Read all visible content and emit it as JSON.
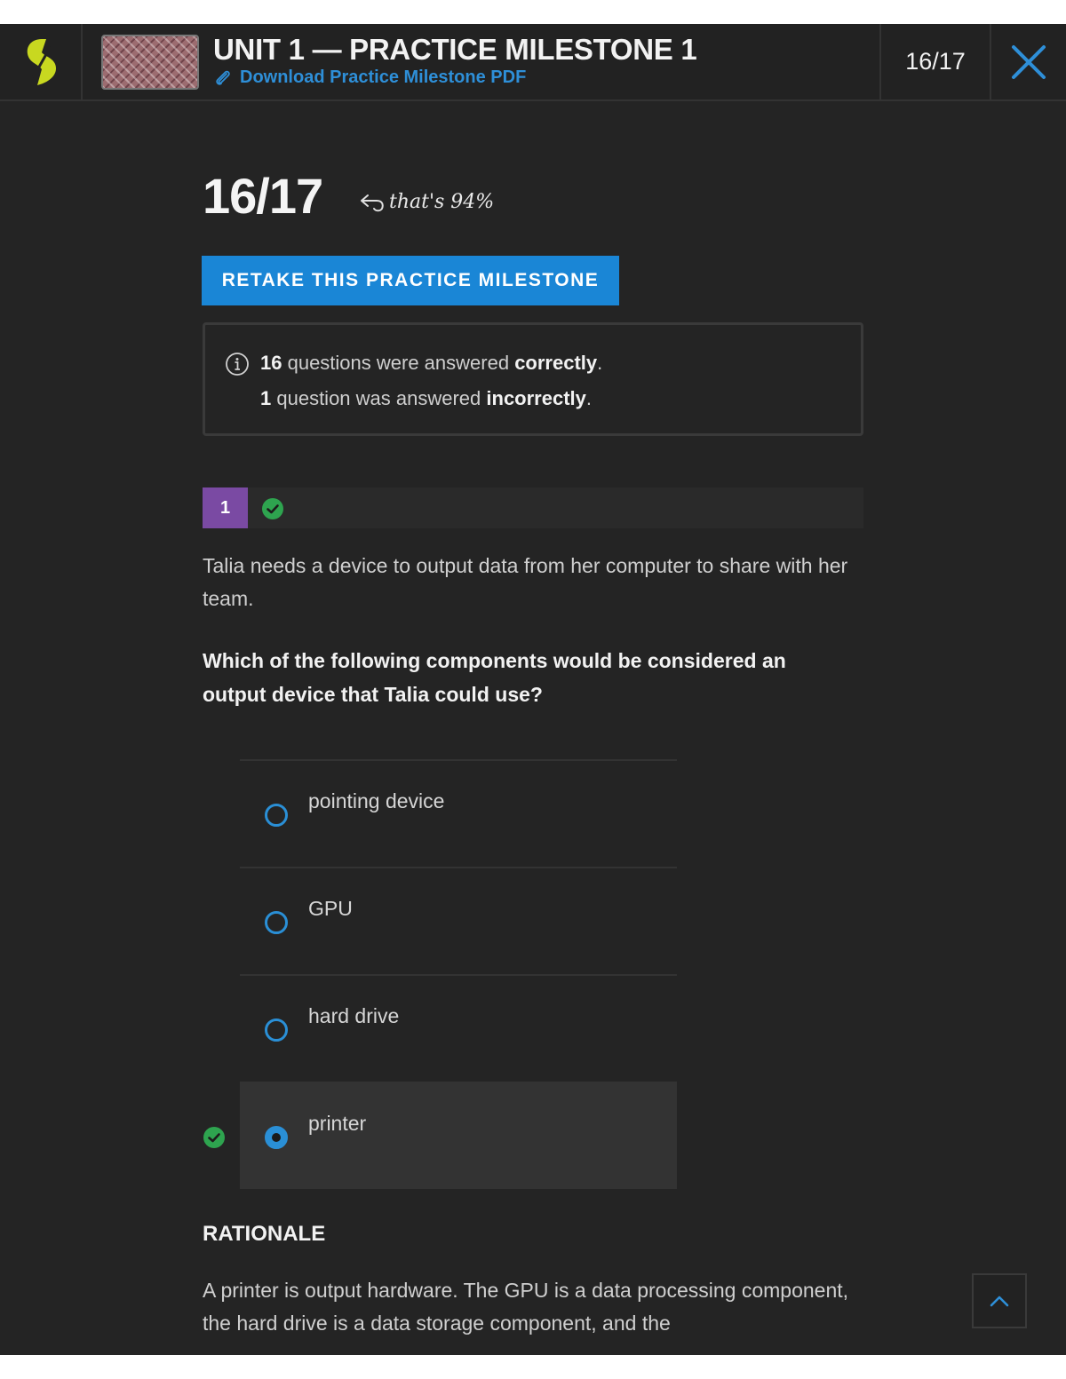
{
  "header": {
    "title": "UNIT 1 — PRACTICE MILESTONE 1",
    "pdf_link": "Download Practice Milestone PDF",
    "score": "16/17"
  },
  "score": {
    "value": "16/17",
    "note": "that's 94%"
  },
  "retake_label": "RETAKE THIS PRACTICE MILESTONE",
  "summary": {
    "correct_count": "16",
    "correct_text_1": " questions were answered ",
    "correct_word": "correctly",
    "incorrect_count": "1",
    "incorrect_text_1": " question was answered ",
    "incorrect_word": "incorrectly",
    "period": "."
  },
  "question": {
    "number": "1",
    "status": "correct",
    "text": "Talia needs a device to output data from her computer to share with her team.",
    "prompt": "Which of the following components would be considered an output device that Talia could use?",
    "options": [
      {
        "label": "pointing device",
        "selected": false
      },
      {
        "label": "GPU",
        "selected": false
      },
      {
        "label": "hard drive",
        "selected": false
      },
      {
        "label": "printer",
        "selected": true,
        "correct": true
      }
    ]
  },
  "rationale": {
    "heading": "RATIONALE",
    "text": "A printer is output hardware. The GPU is a data processing component, the hard drive is a data storage component, and the"
  },
  "colors": {
    "background": "#242424",
    "accent": "#1a86d6",
    "logo": "#c8d820",
    "question_badge": "#7a4aa3",
    "correct": "#2ea44f"
  },
  "icons": [
    "logo-icon",
    "paperclip-icon",
    "close-icon",
    "reply-arrow-icon",
    "info-icon",
    "check-circle-icon",
    "chevron-up-icon"
  ]
}
